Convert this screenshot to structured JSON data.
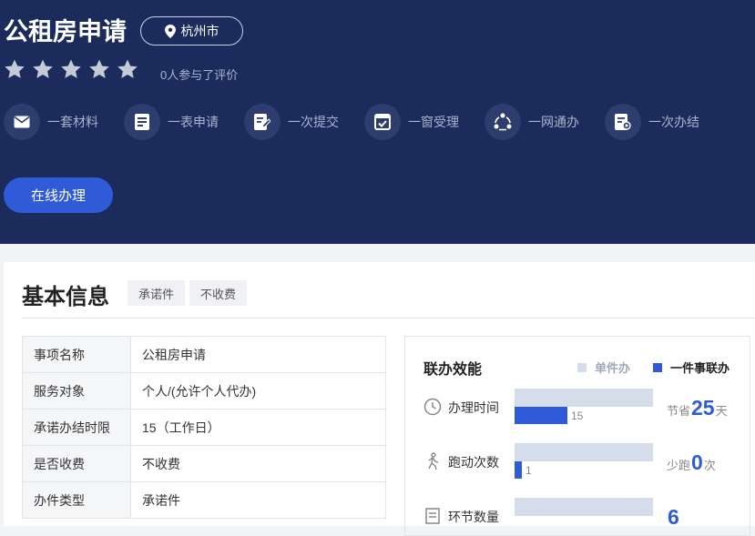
{
  "header": {
    "title": "公租房申请",
    "city": "杭州市",
    "rating_text": "0人参与了评价",
    "stars": 5,
    "features": [
      {
        "label": "一套材料",
        "icon": "envelope-icon"
      },
      {
        "label": "一表申请",
        "icon": "form-icon"
      },
      {
        "label": "一次提交",
        "icon": "edit-doc-icon"
      },
      {
        "label": "一窗受理",
        "icon": "window-check-icon"
      },
      {
        "label": "一网通办",
        "icon": "network-cycle-icon"
      },
      {
        "label": "一次办结",
        "icon": "doc-seal-icon"
      }
    ],
    "online_button": "在线办理"
  },
  "basic_info": {
    "title": "基本信息",
    "tags": [
      "承诺件",
      "不收费"
    ],
    "rows": [
      {
        "key": "事项名称",
        "value": "公租房申请"
      },
      {
        "key": "服务对象",
        "value": "个人/(允许个人代办)"
      },
      {
        "key": "承诺办结时限",
        "value": "15（工作日）"
      },
      {
        "key": "是否收费",
        "value": "不收费"
      },
      {
        "key": "办件类型",
        "value": "承诺件"
      }
    ]
  },
  "performance": {
    "title": "联办效能",
    "legend": {
      "single": "单件办",
      "joint": "一件事联办"
    },
    "colors": {
      "single": "#d5dcea",
      "joint": "#2f5bd8"
    },
    "metrics": [
      {
        "label": "办理时间",
        "icon": "clock-icon",
        "value": "15",
        "fill": 0.38,
        "saving_prefix": "节省",
        "saving_value": "25",
        "saving_suffix": "天"
      },
      {
        "label": "跑动次数",
        "icon": "walk-icon",
        "value": "1",
        "fill": 0.05,
        "saving_prefix": "少跑",
        "saving_value": "0",
        "saving_suffix": "次"
      },
      {
        "label": "环节数量",
        "icon": "list-icon",
        "value": "",
        "fill": 0.0,
        "saving_prefix": "",
        "saving_value": "6",
        "saving_suffix": ""
      }
    ]
  }
}
